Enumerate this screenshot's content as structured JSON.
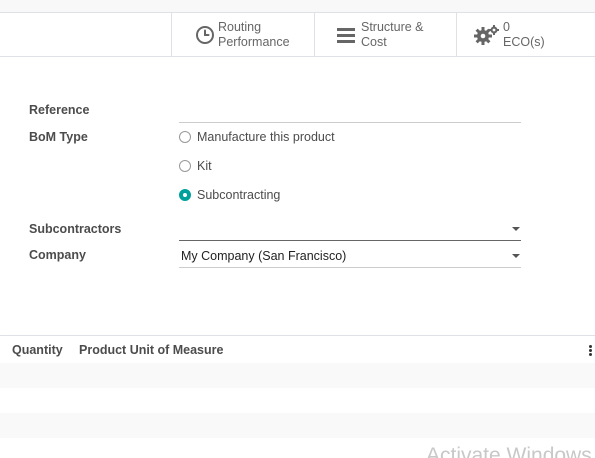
{
  "smart_buttons": [
    {
      "label_line1": "Routing",
      "label_line2": "Performance",
      "icon": "clock-icon"
    },
    {
      "label_line1": "Structure &",
      "label_line2": "Cost",
      "icon": "bars-icon"
    },
    {
      "label_line1": "0",
      "label_line2": "ECO(s)",
      "icon": "gears-icon"
    }
  ],
  "form": {
    "reference_label": "Reference",
    "reference_value": "",
    "bom_type_label": "BoM Type",
    "bom_type_options": [
      {
        "label": "Manufacture this product",
        "checked": false
      },
      {
        "label": "Kit",
        "checked": false
      },
      {
        "label": "Subcontracting",
        "checked": true
      }
    ],
    "subcontractors_label": "Subcontractors",
    "subcontractors_value": "",
    "company_label": "Company",
    "company_value": "My Company (San Francisco)"
  },
  "table": {
    "columns": [
      "Quantity",
      "Product Unit of Measure"
    ]
  },
  "watermark": "Activate Windows",
  "colors": {
    "accent": "#00a09d",
    "border": "#dee2e6"
  }
}
